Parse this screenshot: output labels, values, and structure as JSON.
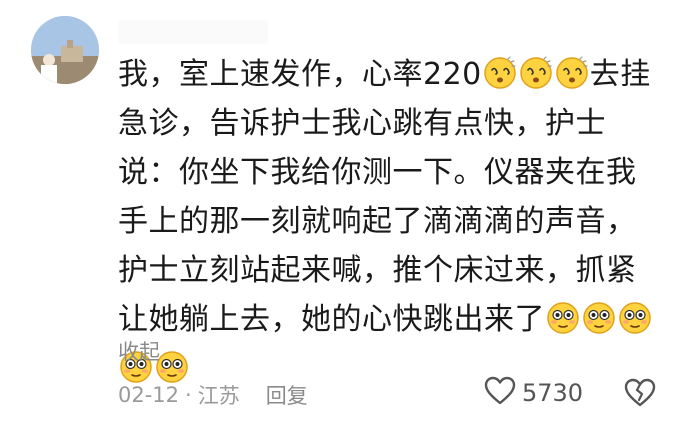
{
  "comment": {
    "text_segments": [
      {
        "type": "text",
        "value": "我，室上速发作，心率220"
      },
      {
        "type": "emoji",
        "name": "dizzy-face-emoji"
      },
      {
        "type": "emoji",
        "name": "dizzy-face-emoji"
      },
      {
        "type": "emoji",
        "name": "dizzy-face-emoji"
      },
      {
        "type": "text",
        "value": "去挂急诊，告诉护士我心跳有点快，护士说：你坐下我给你测一下。仪器夹在我手上的那一刻就响起了滴滴滴的声音，护士立刻站起来喊，推个床过来，抓紧让她躺上去，她的心快跳出来了"
      },
      {
        "type": "emoji",
        "name": "flushed-face-emoji"
      },
      {
        "type": "emoji",
        "name": "flushed-face-emoji"
      },
      {
        "type": "emoji",
        "name": "flushed-face-emoji"
      },
      {
        "type": "emoji",
        "name": "flushed-face-emoji"
      },
      {
        "type": "emoji",
        "name": "flushed-face-emoji"
      }
    ],
    "collapse_label": "收起",
    "date": "02-12",
    "separator": "·",
    "location": "江苏",
    "reply_label": "回复",
    "like_count": "5730"
  },
  "icons": {
    "like": "heart-outline-icon",
    "dislike": "broken-heart-icon"
  },
  "colors": {
    "text": "#1a1a1a",
    "meta": "#9a9a9a",
    "emoji_face": "#ffd23f",
    "emoji_outline": "#e0a21a"
  }
}
